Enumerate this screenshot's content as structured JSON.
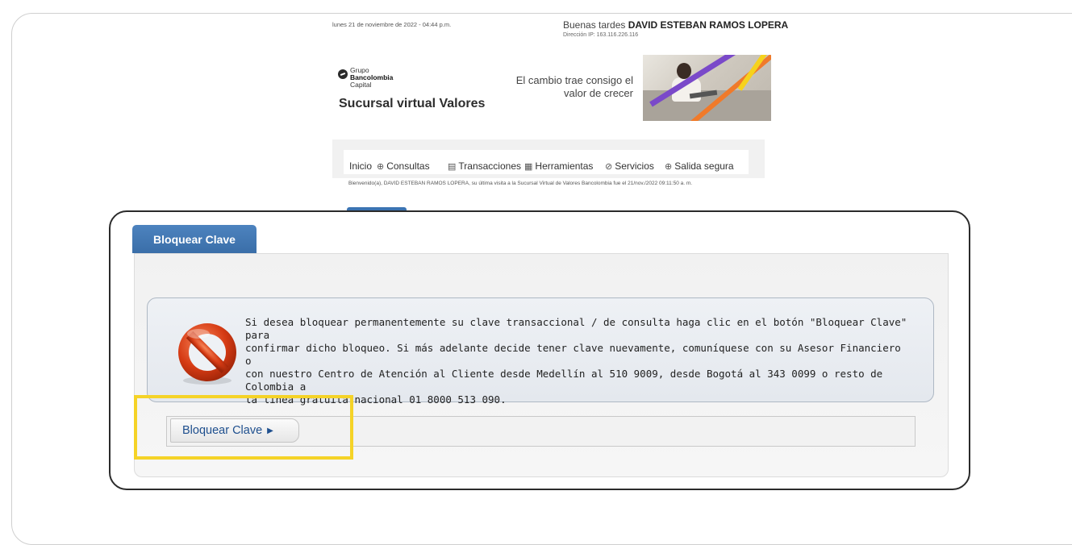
{
  "header": {
    "date": "lunes 21 de noviembre de 2022 - 04:44 p.m.",
    "greeting_prefix": "Buenas tardes",
    "user_name": "DAVID ESTEBAN RAMOS LOPERA",
    "ip_label": "Dirección IP: 163.116.226.116",
    "logo_line1": "Grupo",
    "logo_line2": "Bancolombia",
    "logo_line3": "Capital",
    "branch_title": "Sucursal virtual Valores",
    "slogan_line1": "El cambio trae consigo el",
    "slogan_line2": "valor de crecer"
  },
  "nav": {
    "items": [
      {
        "label": "Inicio",
        "icon": ""
      },
      {
        "label": "Consultas",
        "icon": "search-icon"
      },
      {
        "label": "Transacciones",
        "icon": "transactions-icon"
      },
      {
        "label": "Herramientas",
        "icon": "calculator-icon"
      },
      {
        "label": "Servicios",
        "icon": "check-circle-icon"
      },
      {
        "label": "Salida segura",
        "icon": "lock-icon"
      }
    ],
    "welcome": "Bienvenido(a), DAVID ESTEBAN RAMOS LOPERA, su última visita a la Sucursal Virtual de Valores Bancolombia fue el 21/nov./2022 09:11:50 a. m."
  },
  "panel": {
    "tab_label": "Bloquear Clave",
    "message_line1": "Si desea bloquear permanentemente su clave transaccional / de consulta haga clic en el botón \"Bloquear Clave\" para",
    "message_line2": "confirmar dicho bloqueo. Si más adelante decide tener clave nuevamente, comuníquese con su Asesor Financiero o",
    "message_line3": "con nuestro Centro de Atención al Cliente desde Medellín al 510 9009, desde Bogotá al 343 0099 o resto de Colombia a",
    "message_line4": "la línea gratuita nacional 01 8000 513 090.",
    "button_label": "Bloquear Clave",
    "button_arrow": "▶"
  },
  "colors": {
    "tab_blue": "#3b73b2",
    "link_blue": "#1e4f8e",
    "highlight_yellow": "#f5d327"
  }
}
